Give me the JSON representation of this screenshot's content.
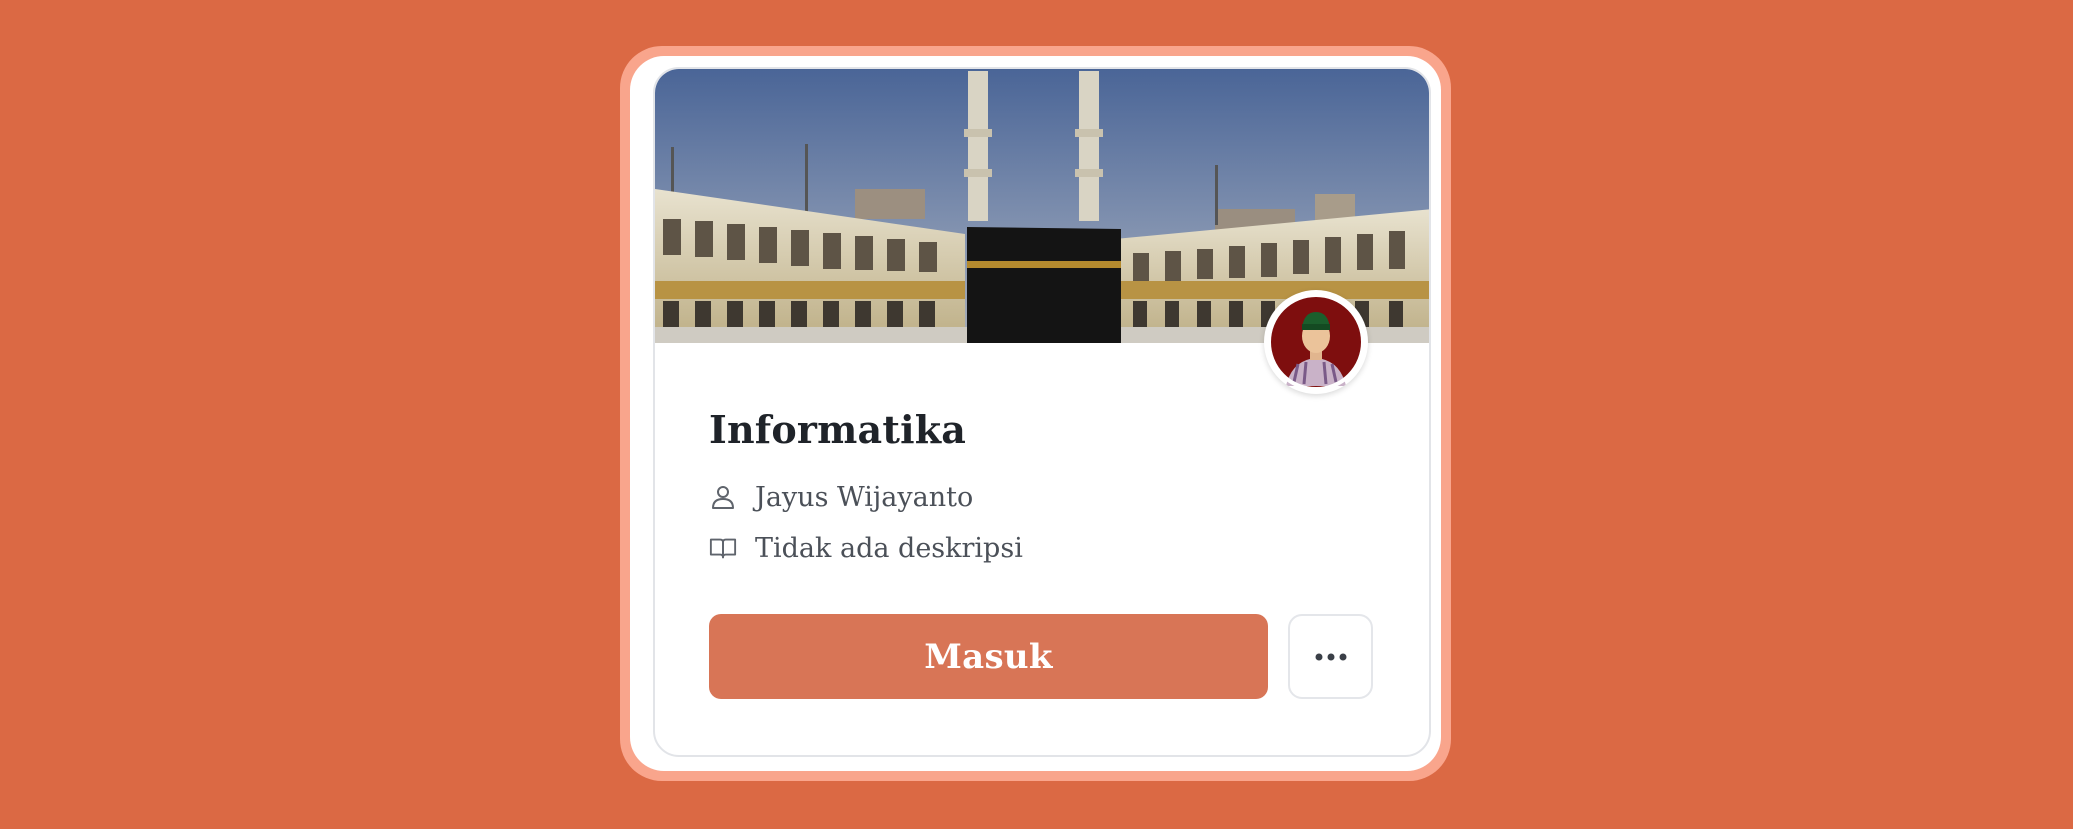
{
  "course": {
    "title": "Informatika",
    "teacher": "Jayus Wijayanto",
    "description": "Tidak ada deskripsi",
    "enter_label": "Masuk"
  },
  "icons": {
    "teacher": "person-icon",
    "description": "open-book-icon",
    "more": "more-horizontal-icon"
  },
  "colors": {
    "background": "#DB6944",
    "frame": "#F9A58C",
    "primary_button": "#D87556",
    "title_text": "#1F2329",
    "meta_text": "#4B5058"
  }
}
